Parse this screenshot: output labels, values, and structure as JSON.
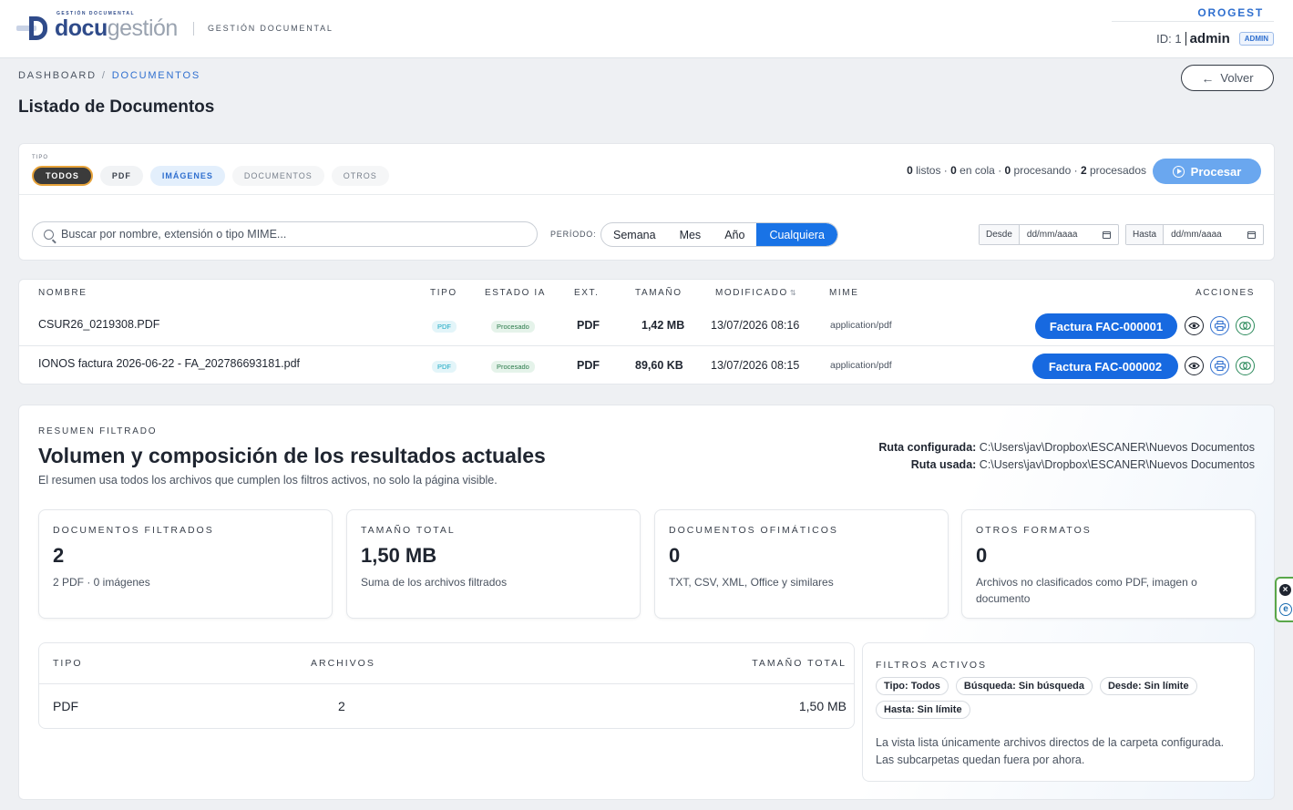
{
  "header": {
    "logo_small": "GESTIÓN DOCUMENTAL",
    "logo_word_a": "docu",
    "logo_word_b": "gestión",
    "subtitle": "GESTIÓN DOCUMENTAL",
    "brand": "OROGEST",
    "user_id": "ID: 1",
    "user_name": "admin",
    "user_role": "ADMIN"
  },
  "breadcrumb": {
    "items": [
      "DASHBOARD",
      "DOCUMENTOS"
    ],
    "separator": "/"
  },
  "page_title": "Listado de Documentos",
  "back_button": "Volver",
  "filters": {
    "tipo_label": "TIPO",
    "chips": [
      {
        "label": "TODOS",
        "state": "active"
      },
      {
        "label": "PDF",
        "state": "normal"
      },
      {
        "label": "IMÁGENES",
        "state": "blue"
      },
      {
        "label": "DOCUMENTOS",
        "state": "muted"
      },
      {
        "label": "OTROS",
        "state": "muted"
      }
    ],
    "queue": {
      "listos": "0",
      "listos_label": " listos · ",
      "cola": "0",
      "cola_label": " en cola · ",
      "procesando": "0",
      "procesando_label": " procesando · ",
      "procesados": "2",
      "procesados_label": " procesados"
    },
    "process_button": "Procesar",
    "search_placeholder": "Buscar por nombre, extensión o tipo MIME...",
    "periodo_label": "PERÍODO:",
    "periods": [
      "Semana",
      "Mes",
      "Año",
      "Cualquiera"
    ],
    "period_selected": "Cualquiera",
    "desde_label": "Desde",
    "hasta_label": "Hasta",
    "date_placeholder": "dd/mm/aaaa"
  },
  "table": {
    "headers": {
      "nombre": "NOMBRE",
      "tipo": "TIPO",
      "estado": "ESTADO IA",
      "ext": "EXT.",
      "tamano": "TAMAÑO",
      "modificado": "MODIFICADO",
      "mime": "MIME",
      "acciones": "ACCIONES"
    },
    "rows": [
      {
        "nombre": "CSUR26_0219308.PDF",
        "tipo": "PDF",
        "estado": "Procesado",
        "ext": "PDF",
        "tamano": "1,42 MB",
        "modificado": "13/07/2026 08:16",
        "mime": "application/pdf",
        "factura": "Factura FAC-000001"
      },
      {
        "nombre": "IONOS factura 2026-06-22 - FA_202786693181.pdf",
        "tipo": "PDF",
        "estado": "Procesado",
        "ext": "PDF",
        "tamano": "89,60 KB",
        "modificado": "13/07/2026 08:15",
        "mime": "application/pdf",
        "factura": "Factura FAC-000002"
      }
    ]
  },
  "summary": {
    "label": "RESUMEN FILTRADO",
    "title": "Volumen y composición de los resultados actuales",
    "subtitle": "El resumen usa todos los archivos que cumplen los filtros activos, no solo la página visible.",
    "ruta_configurada_label": "Ruta configurada:",
    "ruta_configurada": "C:\\Users\\jav\\Dropbox\\ESCANER\\Nuevos Documentos",
    "ruta_usada_label": "Ruta usada:",
    "ruta_usada": "C:\\Users\\jav\\Dropbox\\ESCANER\\Nuevos Documentos",
    "stats": [
      {
        "label": "DOCUMENTOS FILTRADOS",
        "value": "2",
        "desc": "2 PDF · 0 imágenes"
      },
      {
        "label": "TAMAÑO TOTAL",
        "value": "1,50 MB",
        "desc": "Suma de los archivos filtrados"
      },
      {
        "label": "DOCUMENTOS OFIMÁTICOS",
        "value": "0",
        "desc": "TXT, CSV, XML, Office y similares"
      },
      {
        "label": "OTROS FORMATOS",
        "value": "0",
        "desc": "Archivos no clasificados como PDF, imagen o documento"
      }
    ],
    "tipo_table": {
      "headers": [
        "TIPO",
        "ARCHIVOS",
        "TAMAÑO TOTAL"
      ],
      "rows": [
        {
          "tipo": "PDF",
          "archivos": "2",
          "tamano": "1,50 MB"
        }
      ]
    },
    "active_filters": {
      "label": "FILTROS ACTIVOS",
      "tags": [
        "Tipo: Todos",
        "Búsqueda: Sin búsqueda",
        "Desde: Sin límite",
        "Hasta: Sin límite"
      ],
      "note": "La vista lista únicamente archivos directos de la carpeta configurada. Las subcarpetas quedan fuera por ahora."
    }
  }
}
